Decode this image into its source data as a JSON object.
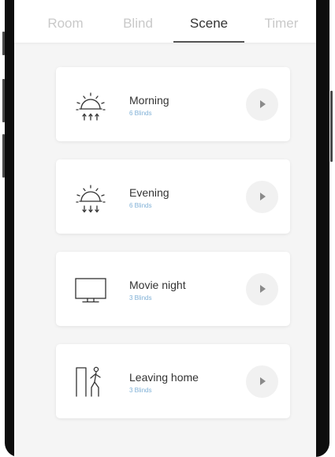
{
  "tabs": [
    {
      "label": "Room",
      "active": false
    },
    {
      "label": "Blind",
      "active": false
    },
    {
      "label": "Scene",
      "active": true
    },
    {
      "label": "Timer",
      "active": false
    }
  ],
  "scenes": [
    {
      "name": "Morning",
      "blinds": "6 Blinds",
      "icon": "sunrise-icon"
    },
    {
      "name": "Evening",
      "blinds": "6 Blinds",
      "icon": "sunset-icon"
    },
    {
      "name": "Movie night",
      "blinds": "3 Blinds",
      "icon": "tv-icon"
    },
    {
      "name": "Leaving home",
      "blinds": "3 Blinds",
      "icon": "leaving-home-icon"
    }
  ],
  "colors": {
    "active_tab": "#333333",
    "inactive_tab": "#c9c9c9",
    "subtitle": "#7fb0d6",
    "background": "#f5f5f5"
  }
}
